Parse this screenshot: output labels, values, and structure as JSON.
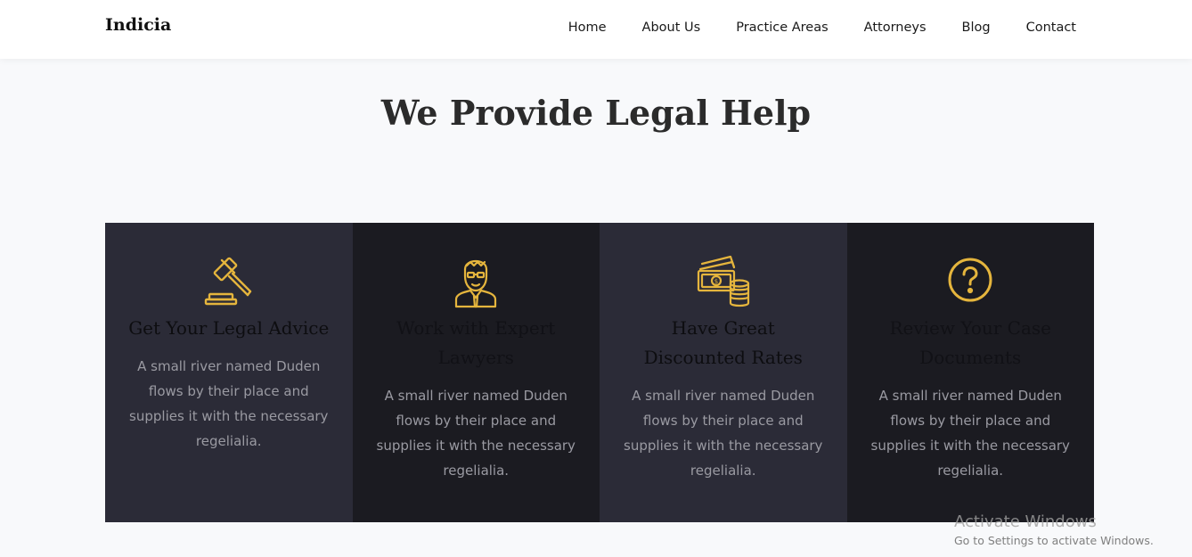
{
  "brand": {
    "name": "Indicia"
  },
  "nav": {
    "items": [
      {
        "label": "Home"
      },
      {
        "label": "About Us"
      },
      {
        "label": "Practice Areas"
      },
      {
        "label": "Attorneys"
      },
      {
        "label": "Blog"
      },
      {
        "label": "Contact"
      }
    ]
  },
  "section": {
    "title": "We Provide Legal Help"
  },
  "services": [
    {
      "icon": "gavel-icon",
      "title": "Get Your Legal Advice",
      "text": "A small river named Duden flows by their place and supplies it with the necessary regelialia."
    },
    {
      "icon": "lawyer-icon",
      "title": "Work with Expert Lawyers",
      "text": "A small river named Duden flows by their place and supplies it with the necessary regelialia."
    },
    {
      "icon": "money-coins-icon",
      "title": "Have Great Discounted Rates",
      "text": "A small river named Duden flows by their place and supplies it with the necessary regelialia."
    },
    {
      "icon": "question-circle-icon",
      "title": "Review Your Case Documents",
      "text": "A small river named Duden flows by their place and supplies it with the necessary regelialia."
    }
  ],
  "colors": {
    "accent": "#e5b53d",
    "card_light": "#2b2b37",
    "card_dark": "#1b1b21",
    "page_bg": "#f8f9fb"
  },
  "watermark": {
    "title": "Activate Windows",
    "subtitle": "Go to Settings to activate Windows."
  }
}
